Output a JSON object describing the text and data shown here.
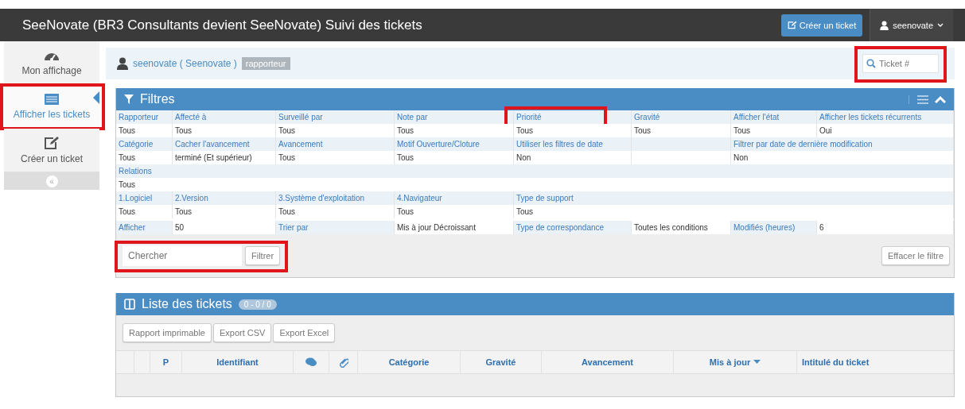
{
  "header": {
    "title": "SeeNovate (BR3 Consultants devient SeeNovate) Suivi des tickets",
    "create_button": "Créer un ticket",
    "user_menu": "seenovate"
  },
  "sidebar": {
    "items": [
      {
        "label": "Mon affichage",
        "selected": false,
        "highlighted": false
      },
      {
        "label": "Afficher les tickets",
        "selected": true,
        "highlighted": true
      },
      {
        "label": "Créer un ticket",
        "selected": false,
        "highlighted": false
      }
    ],
    "collapse_button": "«"
  },
  "breadcrumb": {
    "user": "seenovate ( Seenovate )",
    "role": "rapporteur",
    "ticket_search": {
      "placeholder": "Ticket #",
      "highlighted": true
    }
  },
  "filters": {
    "title": "Filtres",
    "rows": [
      {
        "kind": "stacked",
        "fields": [
          {
            "label": "Rapporteur",
            "value": "Tous"
          },
          {
            "label": "Affecté à",
            "value": "Tous"
          },
          {
            "label": "Surveillé par",
            "value": "Tous"
          },
          {
            "label": "Note par",
            "value": "Tous"
          },
          {
            "label": "Priorité",
            "value": "Tous",
            "highlighted": true
          },
          {
            "label": "Gravité",
            "value": "Tous"
          },
          {
            "label": "Afficher l'état",
            "value": "Tous"
          },
          {
            "label": "Afficher les tickets récurrents",
            "value": "Oui"
          }
        ]
      },
      {
        "kind": "stacked",
        "fields": [
          {
            "label": "Catégorie",
            "value": "Tous"
          },
          {
            "label": "Cacher l'avancement",
            "value": "terminé (Et supérieur)"
          },
          {
            "label": "Avancement",
            "value": "Tous"
          },
          {
            "label": "Motif Ouverture/Cloture",
            "value": "Tous"
          },
          {
            "label": "Utiliser les filtres de date",
            "value": "Non"
          },
          {
            "kind": "shifted",
            "label": "Filtrer par date de dernière modification",
            "value": "Non"
          }
        ]
      },
      {
        "kind": "stacked",
        "fields": [
          {
            "label": "Relations",
            "value": "Tous"
          }
        ]
      },
      {
        "kind": "stacked",
        "fields": [
          {
            "label": "1.Logiciel",
            "value": "Tous"
          },
          {
            "label": "2.Version",
            "value": "Tous"
          },
          {
            "label": "3.Système d'exploitation",
            "value": "Tous"
          },
          {
            "label": "4.Navigateur",
            "value": "Tous"
          },
          {
            "label": "Type de support",
            "value": "Tous"
          }
        ]
      },
      {
        "kind": "inline",
        "fields": [
          {
            "label": "Afficher",
            "value": "50"
          },
          {
            "label": "Trier par",
            "value": "Mis à jour Décroissant"
          },
          {
            "label": "Type de correspondance",
            "value": "Toutes les conditions"
          },
          {
            "label": "Modifiés (heures)",
            "value": "6"
          }
        ]
      }
    ],
    "search": {
      "placeholder": "Chercher",
      "button": "Filtrer",
      "highlighted": true
    },
    "clear_button": "Effacer le filtre"
  },
  "tickets": {
    "title": "Liste des tickets",
    "count": "0 - 0 / 0",
    "buttons": [
      "Rapport imprimable",
      "Export CSV",
      "Export Excel"
    ],
    "columns": [
      {
        "kind": "blank"
      },
      {
        "kind": "blank"
      },
      {
        "kind": "text",
        "label": "P"
      },
      {
        "kind": "text",
        "label": "Identifiant"
      },
      {
        "kind": "comments"
      },
      {
        "kind": "attachments"
      },
      {
        "kind": "text",
        "label": "Catégorie"
      },
      {
        "kind": "text",
        "label": "Gravité"
      },
      {
        "kind": "text",
        "label": "Avancement"
      },
      {
        "kind": "text",
        "label": "Mis à jour",
        "sorted": true
      },
      {
        "kind": "text",
        "label": "Intitulé du ticket"
      }
    ]
  }
}
